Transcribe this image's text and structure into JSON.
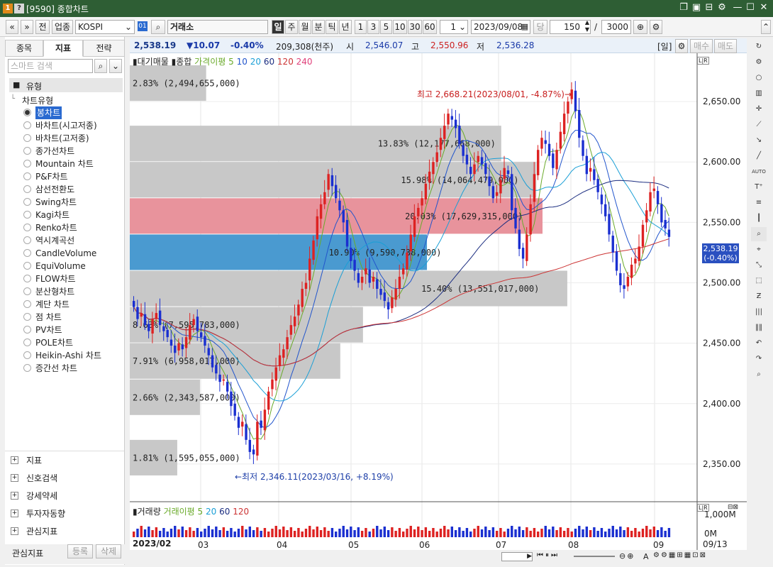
{
  "window": {
    "title": "[9590] 종합차트",
    "badge1": "1",
    "badge2": "?"
  },
  "toolbar": {
    "nav_prev": "«",
    "nav_down": "»",
    "btn_prev": "전",
    "sector": "업종",
    "market": "KOSPI",
    "code_badge": "01",
    "search_icon": "⌕",
    "exchange": "거래소",
    "periods": [
      "일",
      "주",
      "월",
      "분",
      "틱",
      "년"
    ],
    "active_period": "일",
    "intervals": [
      "1",
      "3",
      "5",
      "10",
      "30",
      "60"
    ],
    "count": "1",
    "date": "2023/09/08",
    "dang": "당",
    "bars": "150",
    "slash": "/",
    "max": "3000"
  },
  "left_panel": {
    "tabs": [
      "종목",
      "지표",
      "전략"
    ],
    "active_tab": "지표",
    "search_placeholder": "스마트 검색",
    "folder_label": "유형",
    "group_label": "차트유형",
    "items": [
      "봉차트",
      "바차트(시고저종)",
      "바차트(고저종)",
      "종가선차트",
      "Mountain 차트",
      "P&F차트",
      "삼선전환도",
      "Swing차트",
      "Kagi차트",
      "Renko차트",
      "역시계곡선",
      "CandleVolume",
      "EquiVolume",
      "FLOW차트",
      "분산형차트",
      "계단 차트",
      "점 차트",
      "PV차트",
      "POLE차트",
      "Heikin-Ashi 차트",
      "증간선 차트"
    ],
    "selected": "봉차트",
    "accordions": [
      "지표",
      "신호검색",
      "강세약세",
      "투자자동향",
      "관심지표"
    ],
    "footer_label": "관심지표",
    "footer_register": "등록",
    "footer_delete": "삭제"
  },
  "quote": {
    "price": "2,538.19",
    "change": "▼10.07",
    "pct": "-0.40%",
    "volume": "209,308(천주)",
    "open_lbl": "시",
    "open": "2,546.07",
    "high_lbl": "고",
    "high": "2,550.96",
    "low_lbl": "저",
    "low": "2,536.28",
    "period_tag": "[일]",
    "buy": "매수",
    "sell": "매도"
  },
  "legend_price": {
    "label1": "대기매물",
    "label2": "종합",
    "ma_label": "가격이평 5",
    "mas": [
      {
        "n": "10",
        "color": "#2255cc"
      },
      {
        "n": "20",
        "color": "#1a9fd6"
      },
      {
        "n": "60",
        "color": "#1b2d80"
      },
      {
        "n": "120",
        "color": "#cc3333"
      },
      {
        "n": "240",
        "color": "#e0407a"
      }
    ],
    "ma5_color": "#6aaa2a"
  },
  "legend_volume": {
    "label": "거래량",
    "ma_label": "거래이평 5",
    "mas": [
      "20",
      "60",
      "120"
    ]
  },
  "chart_data": {
    "type": "candlestick",
    "y_range": [
      2320,
      2690
    ],
    "y_ticks": [
      "2,650.00",
      "2,600.00",
      "2,550.00",
      "2,500.00",
      "2,450.00",
      "2,400.00",
      "2,350.00"
    ],
    "y_tick_values": [
      2650,
      2600,
      2550,
      2500,
      2450,
      2400,
      2350
    ],
    "x_labels": [
      "2023/02",
      "03",
      "04",
      "05",
      "06",
      "07",
      "08",
      "09",
      "09/13"
    ],
    "last_price_box": {
      "price": "2,538.19",
      "pct": "(-0.40%)",
      "value": 2538.19
    },
    "annotations": {
      "high": "최고 2,668.21(2023/08/01, -4.87%)→",
      "low": "←최저 2,346.11(2023/03/16, +8.19%)"
    },
    "volume_profile": [
      {
        "low": 2650,
        "high": 2680,
        "pct": "2.83%",
        "vol": "2,494,655,000",
        "frac": 0.185
      },
      {
        "low": 2600,
        "high": 2630,
        "pct": "13.83%",
        "vol": "12,177,668,000",
        "frac": 0.9
      },
      {
        "low": 2570,
        "high": 2600,
        "pct": "15.98%",
        "vol": "14,064,479,000",
        "frac": 0.985
      },
      {
        "low": 2540,
        "high": 2570,
        "pct": "20.03%",
        "vol": "17,629,315,000",
        "frac": 1.0
      },
      {
        "low": 2510,
        "high": 2540,
        "pct": "10.90%",
        "vol": "9,590,738,000",
        "frac": 0.72
      },
      {
        "low": 2480,
        "high": 2510,
        "pct": "15.40%",
        "vol": "13,551,017,000",
        "frac": 1.06
      },
      {
        "low": 2450,
        "high": 2480,
        "pct": "8.63%",
        "vol": "7,595,783,000",
        "frac": 0.565
      },
      {
        "low": 2420,
        "high": 2450,
        "pct": "7.91%",
        "vol": "6,958,017,000",
        "frac": 0.51
      },
      {
        "low": 2390,
        "high": 2420,
        "pct": "2.66%",
        "vol": "2,343,587,000",
        "frac": 0.17
      },
      {
        "low": 2340,
        "high": 2370,
        "pct": "1.81%",
        "vol": "1,595,055,000",
        "frac": 0.115
      }
    ],
    "closes": [
      2480,
      2470,
      2475,
      2465,
      2460,
      2470,
      2475,
      2465,
      2460,
      2455,
      2448,
      2442,
      2450,
      2445,
      2455,
      2465,
      2470,
      2460,
      2455,
      2448,
      2440,
      2430,
      2425,
      2418,
      2420,
      2410,
      2398,
      2390,
      2380,
      2385,
      2370,
      2360,
      2358,
      2385,
      2380,
      2395,
      2410,
      2420,
      2430,
      2440,
      2445,
      2455,
      2465,
      2472,
      2482,
      2495,
      2500,
      2520,
      2535,
      2555,
      2565,
      2575,
      2590,
      2580,
      2570,
      2560,
      2550,
      2530,
      2518,
      2510,
      2500,
      2505,
      2512,
      2500,
      2505,
      2495,
      2490,
      2485,
      2478,
      2488,
      2495,
      2505,
      2512,
      2525,
      2540,
      2555,
      2562,
      2570,
      2582,
      2592,
      2600,
      2608,
      2620,
      2630,
      2640,
      2635,
      2628,
      2615,
      2605,
      2598,
      2590,
      2598,
      2605,
      2598,
      2590,
      2580,
      2570,
      2575,
      2585,
      2595,
      2590,
      2560,
      2545,
      2528,
      2520,
      2540,
      2565,
      2590,
      2610,
      2620,
      2615,
      2605,
      2595,
      2610,
      2625,
      2640,
      2650,
      2660,
      2642,
      2620,
      2605,
      2590,
      2595,
      2585,
      2575,
      2565,
      2555,
      2540,
      2525,
      2510,
      2498,
      2495,
      2505,
      2515,
      2520,
      2530,
      2548,
      2560,
      2575,
      2578,
      2565,
      2550,
      2545,
      2538
    ]
  },
  "volume_axis": {
    "ticks": [
      "1,000M",
      "0M"
    ]
  },
  "scroll": {
    "label": "A"
  }
}
